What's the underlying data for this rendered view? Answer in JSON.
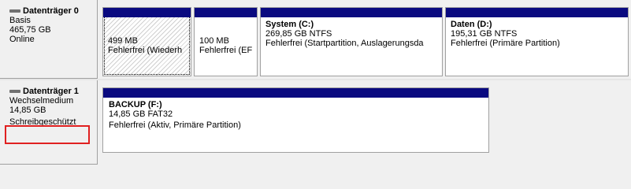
{
  "disks": [
    {
      "title": "Datenträger 0",
      "type": "Basis",
      "size": "465,75 GB",
      "status": "Online",
      "partitions": [
        {
          "name": "",
          "line1": "499 MB",
          "line2": "Fehlerfrei (Wiederh"
        },
        {
          "name": "",
          "line1": "100 MB",
          "line2": "Fehlerfrei (EF"
        },
        {
          "name": "System  (C:)",
          "line1": "269,85 GB NTFS",
          "line2": "Fehlerfrei (Startpartition, Auslagerungsda"
        },
        {
          "name": "Daten  (D:)",
          "line1": "195,31 GB NTFS",
          "line2": "Fehlerfrei (Primäre Partition)"
        }
      ]
    },
    {
      "title": "Datenträger 1",
      "type": "Wechselmedium",
      "size": "14,85 GB",
      "status": "Schreibgeschützt",
      "partitions": [
        {
          "name": "BACKUP  (F:)",
          "line1": "14,85 GB FAT32",
          "line2": "Fehlerfrei (Aktiv, Primäre Partition)"
        }
      ]
    }
  ],
  "colors": {
    "partition_bar": "#0a0a80",
    "highlight_box": "#e02020"
  }
}
